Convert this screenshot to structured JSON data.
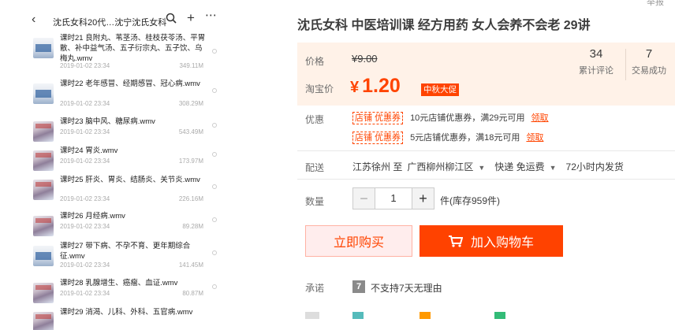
{
  "header_link": "举报",
  "phone": {
    "title": "沈氏女科20代…沈宁沈氏女科",
    "back_icon": "back-arrow-icon",
    "videos": [
      {
        "name": "课时21 良附丸、苇茎汤、桂枝茯苓汤、平胃散、补中益气汤、五子衍宗丸、五子饮、乌梅丸.wmv",
        "date": "2019-01-02 23:34",
        "size": "349.11M",
        "thumb": "doc"
      },
      {
        "name": "课时22 老年感冒、经期感冒、冠心病.wmv",
        "date": "2019-01-02 23:34",
        "size": "308.29M",
        "thumb": "doc"
      },
      {
        "name": "课时23 脑中风、糖尿病.wmv",
        "date": "2019-01-02 23:34",
        "size": "543.49M",
        "thumb": "person"
      },
      {
        "name": "课时24 胃炎.wmv",
        "date": "2019-01-02 23:34",
        "size": "173.97M",
        "thumb": "person"
      },
      {
        "name": "课时25 肝炎、胃炎、结肠炎、关节炎.wmv",
        "date": "2019-01-02 23:34",
        "size": "226.16M",
        "thumb": "person"
      },
      {
        "name": "课时26 月经病.wmv",
        "date": "2019-01-02 23:34",
        "size": "89.28M",
        "thumb": "person"
      },
      {
        "name": "课时27 带下病、不孕不育、更年期综合征.wmv",
        "date": "2019-01-02 23:34",
        "size": "141.45M",
        "thumb": "doc"
      },
      {
        "name": "课时28 乳腺增生、癌瘤、血证.wmv",
        "date": "2019-01-02 23:34",
        "size": "80.87M",
        "thumb": "person"
      },
      {
        "name": "课时29 消渴、儿科、外科、五官病.wmv",
        "date": "",
        "size": "",
        "thumb": "person"
      }
    ]
  },
  "product": {
    "title": "沈氏女科 中医培训课 经方用药 女人会养不会老 29讲",
    "price_label": "价格",
    "old_price": "¥9.00",
    "promo_price_label": "淘宝价",
    "currency": "¥",
    "promo_price": "1.20",
    "promo_tag": "中秋大促",
    "stats": [
      {
        "count": "34",
        "label": "累计评论"
      },
      {
        "count": "7",
        "label": "交易成功"
      }
    ],
    "discount_label": "优惠",
    "coupons": [
      {
        "tag": "店铺  优惠券",
        "text": "10元店铺优惠券，满29元可用",
        "claim": "领取"
      },
      {
        "tag": "店铺  优惠券",
        "text": "5元店铺优惠券，满18元可用",
        "claim": "领取"
      }
    ],
    "delivery_label": "配送",
    "delivery": {
      "from": "江苏徐州 至",
      "to": "广西柳州柳江区",
      "method": "快递 免运费",
      "dispatch": "72小时内发货"
    },
    "quantity_label": "数量",
    "quantity": "1",
    "stock": "件(库存959件)",
    "buy_now": "立即购买",
    "add_to_cart": "加入购物车",
    "promise_label": "承诺",
    "promise_icon_glyph": "7",
    "promise_text": "不支持7天无理由"
  },
  "colors": {
    "accent": "#ff4400",
    "price_bg": "#fff2e8",
    "cart_bg": "#ff4200",
    "buy_bg": "#ffeded"
  }
}
